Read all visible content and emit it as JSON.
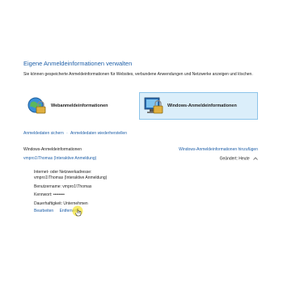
{
  "page": {
    "title": "Eigene Anmeldeinformationen verwalten",
    "description": "Sie können gespeicherte Anmeldeinformationen für Websites, verbundene Anwendungen und Netzwerke anzeigen und löschen."
  },
  "tiles": {
    "web_label": "Webanmeldeinformationen",
    "windows_label": "Windows-Anmeldeinformationen"
  },
  "links": {
    "backup": "Anmeldedaten sichern",
    "restore": "Anmeldedaten wiederherstellen",
    "separator": "·"
  },
  "section": {
    "heading": "Windows-Anmeldeinformationen",
    "add_link": "Windows-Anmeldeinformationen hinzufügen"
  },
  "credential": {
    "name": "vmpro1\\Thomas (Interaktive Anmeldung)",
    "changed": "Geändert:  Heute",
    "address_label": "Internet- oder Netzwerkadresse:",
    "address_value": "vmpro1\\Thomas (Interaktive Anmeldung)",
    "username": "Benutzername:  vmpro1\\Thomas",
    "password": "Kennwort:  ••••••••",
    "persistence": "Dauerhaftigkeit:  Unternehmen"
  },
  "actions": {
    "edit": "Bearbeiten",
    "remove": "Entfernen"
  },
  "colors": {
    "link": "#1e5fa8",
    "selected_tile_bg": "#dbeefa",
    "selected_tile_border": "#8cc4ea",
    "cursor_highlight": "#f5e63a"
  }
}
